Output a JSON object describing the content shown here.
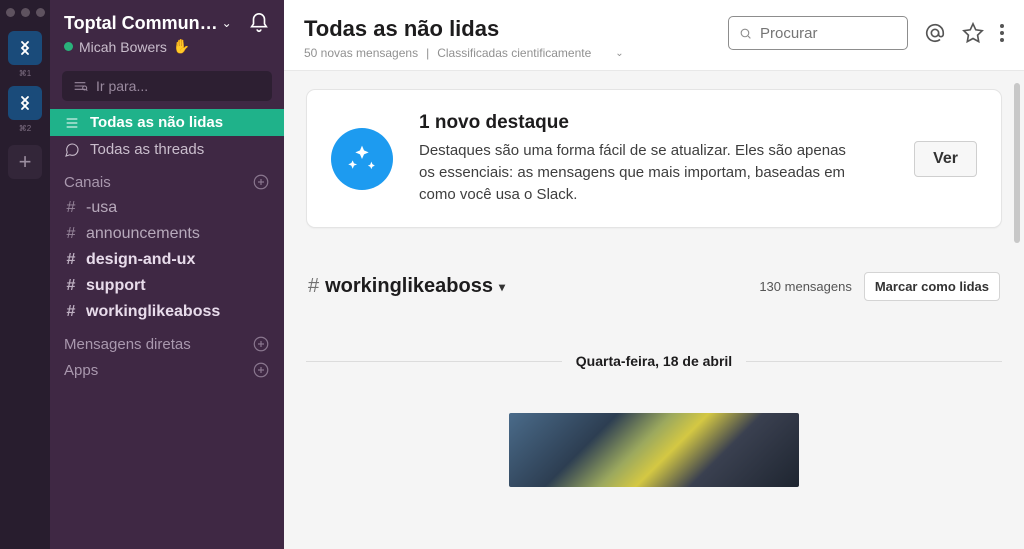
{
  "rail": {
    "ws1_shortcut": "⌘1",
    "ws2_shortcut": "⌘2"
  },
  "sidebar": {
    "workspace_name": "Toptal Commun…",
    "user_name": "Micah Bowers",
    "user_emoji": "✋",
    "jump_placeholder": "Ir para...",
    "nav_unread": "Todas as não lidas",
    "nav_threads": "Todas as threads",
    "section_channels": "Canais",
    "channels": [
      {
        "name": "-usa",
        "bold": false
      },
      {
        "name": "announcements",
        "bold": false
      },
      {
        "name": "design-and-ux",
        "bold": true
      },
      {
        "name": "support",
        "bold": true
      },
      {
        "name": "workinglikeaboss",
        "bold": true
      }
    ],
    "section_dm": "Mensagens diretas",
    "section_apps": "Apps"
  },
  "topbar": {
    "title": "Todas as não lidas",
    "subtitle_left": "50 novas mensagens",
    "subtitle_right": "Classificadas cientificamente",
    "search_placeholder": "Procurar"
  },
  "highlight": {
    "title": "1 novo destaque",
    "body": "Destaques são uma forma fácil de se atualizar. Eles são apenas os essenciais: as mensagens que mais importam, baseadas em como você usa o Slack.",
    "button": "Ver"
  },
  "channel_section": {
    "hash": "#",
    "name": "workinglikeaboss",
    "count": "130 mensagens",
    "mark_read": "Marcar como lidas"
  },
  "date_divider": "Quarta-feira, 18 de abril"
}
